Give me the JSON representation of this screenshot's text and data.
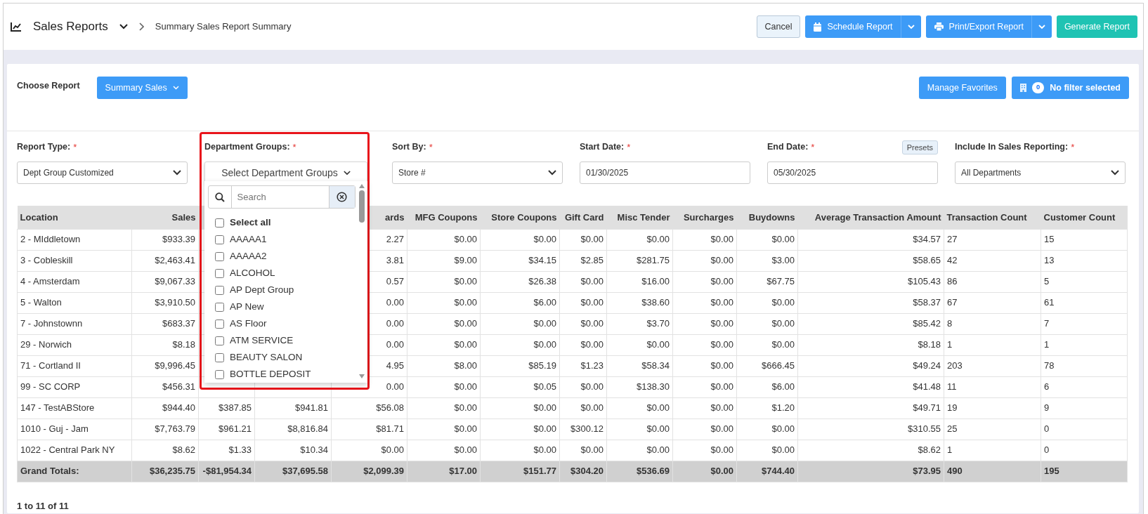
{
  "header": {
    "title": "Sales Reports",
    "breadcrumb": "Summary Sales Report Summary",
    "cancel_button": "Cancel",
    "schedule_button": "Schedule Report",
    "print_button": "Print/Export Report",
    "generate_button": "Generate Report"
  },
  "report_bar": {
    "label": "Choose Report",
    "report_button": "Summary Sales",
    "favorites_button": "Manage Favorites",
    "filter_button": {
      "count": "0",
      "label": "No filter selected"
    }
  },
  "filters": [
    {
      "kind": "select",
      "label": "Report Type:",
      "required_mark": "*",
      "value": "Dept Group Customized"
    },
    {
      "kind": "multiselect",
      "label": "Department Groups:",
      "required_mark": "*",
      "placeholder": "Select Department Groups"
    },
    {
      "kind": "select",
      "label": "Sort By:",
      "required_mark": "*",
      "value": "Store #"
    },
    {
      "kind": "date",
      "label": "Start Date:",
      "required_mark": "*",
      "value": "01/30/2025"
    },
    {
      "kind": "date",
      "label": "End Date:",
      "required_mark": "*",
      "value": "05/30/2025",
      "presets": "Presets"
    },
    {
      "kind": "select",
      "label": "Include In Sales Reporting:",
      "required_mark": "*",
      "value": "All Departments"
    }
  ],
  "department_menu": {
    "search_placeholder": "Search",
    "highlighted": true,
    "items": [
      {
        "label": "Select all",
        "checked": false,
        "kind": "all"
      },
      {
        "label": "AAAAA1",
        "checked": false,
        "kind": "option"
      },
      {
        "label": "AAAAA2",
        "checked": false,
        "kind": "option"
      },
      {
        "label": "ALCOHOL",
        "checked": false,
        "kind": "option"
      },
      {
        "label": "AP Dept Group",
        "checked": false,
        "kind": "option"
      },
      {
        "label": "AP New",
        "checked": false,
        "kind": "option"
      },
      {
        "label": "AS Floor",
        "checked": false,
        "kind": "option"
      },
      {
        "label": "ATM SERVICE",
        "checked": false,
        "kind": "option"
      },
      {
        "label": "BEAUTY SALON",
        "checked": false,
        "kind": "option"
      },
      {
        "label": "BOTTLE DEPOSIT",
        "checked": false,
        "kind": "option"
      }
    ]
  },
  "table": {
    "columns": [
      "Location",
      "Sales",
      null,
      null,
      "ards",
      "MFG Coupons",
      "Store Coupons",
      "Gift Card",
      "Misc Tender",
      "Surcharges",
      "Buydowns",
      "Average Transaction Amount",
      "Transaction Count",
      "Customer Count"
    ],
    "rows": [
      [
        "2 - MIddletown",
        "$933.39",
        null,
        null,
        "2.27",
        "$0.00",
        "$0.00",
        "$0.00",
        "$0.00",
        "$0.00",
        "$0.00",
        "$34.57",
        "27",
        "15"
      ],
      [
        "3 - Cobleskill",
        "$2,463.41",
        null,
        null,
        "3.81",
        "$9.00",
        "$34.15",
        "$2.85",
        "$281.75",
        "$0.00",
        "$3.00",
        "$58.65",
        "42",
        "13"
      ],
      [
        "4 - Amsterdam",
        "$9,067.33",
        null,
        null,
        "0.57",
        "$0.00",
        "$26.38",
        "$0.00",
        "$16.00",
        "$0.00",
        "$67.75",
        "$105.43",
        "86",
        "5"
      ],
      [
        "5 - Walton",
        "$3,910.50",
        null,
        null,
        "0.00",
        "$0.00",
        "$6.00",
        "$0.00",
        "$38.60",
        "$0.00",
        "$0.00",
        "$58.37",
        "67",
        "61"
      ],
      [
        "7 - Johnstownn",
        "$683.37",
        null,
        null,
        "0.00",
        "$0.00",
        "$0.00",
        "$0.00",
        "$3.70",
        "$0.00",
        "$0.00",
        "$85.42",
        "8",
        "7"
      ],
      [
        "29 - Norwich",
        "$8.18",
        null,
        null,
        "0.00",
        "$0.00",
        "$0.00",
        "$0.00",
        "$0.00",
        "$0.00",
        "$0.00",
        "$8.18",
        "1",
        "1"
      ],
      [
        "71 - Cortland II",
        "$9,996.45",
        null,
        null,
        "4.95",
        "$8.00",
        "$85.19",
        "$1.23",
        "$58.34",
        "$0.00",
        "$666.45",
        "$49.24",
        "203",
        "78"
      ],
      [
        "99 - SC CORP",
        "$456.31",
        null,
        null,
        "0.00",
        "$0.00",
        "$0.05",
        "$0.00",
        "$138.30",
        "$0.00",
        "$6.00",
        "$41.48",
        "11",
        "6"
      ],
      [
        "147 - TestABStore",
        "$944.40",
        "$387.85",
        "$941.81",
        "$56.08",
        "$0.00",
        "$0.00",
        "$0.00",
        "$0.00",
        "$0.00",
        "$1.20",
        "$49.71",
        "19",
        "9"
      ],
      [
        "1010 - Guj - Jam",
        "$7,763.79",
        "$961.21",
        "$8,816.84",
        "$81.71",
        "$0.00",
        "$0.00",
        "$300.12",
        "$0.00",
        "$0.00",
        "$0.00",
        "$310.55",
        "25",
        "0"
      ],
      [
        "1022 - Central Park NY",
        "$8.62",
        "$1.33",
        "$10.34",
        "$0.00",
        "$0.00",
        "$0.00",
        "$0.00",
        "$0.00",
        "$0.00",
        "$0.00",
        "$8.62",
        "1",
        "0"
      ]
    ],
    "totals": [
      "Grand Totals:",
      "$36,235.75",
      "-$81,954.34",
      "$37,695.58",
      "$2,099.39",
      "$17.00",
      "$151.77",
      "$304.20",
      "$536.69",
      "$0.00",
      "$744.40",
      "$73.95",
      "490",
      "195"
    ]
  },
  "pagination": "1 to 11 of 11"
}
